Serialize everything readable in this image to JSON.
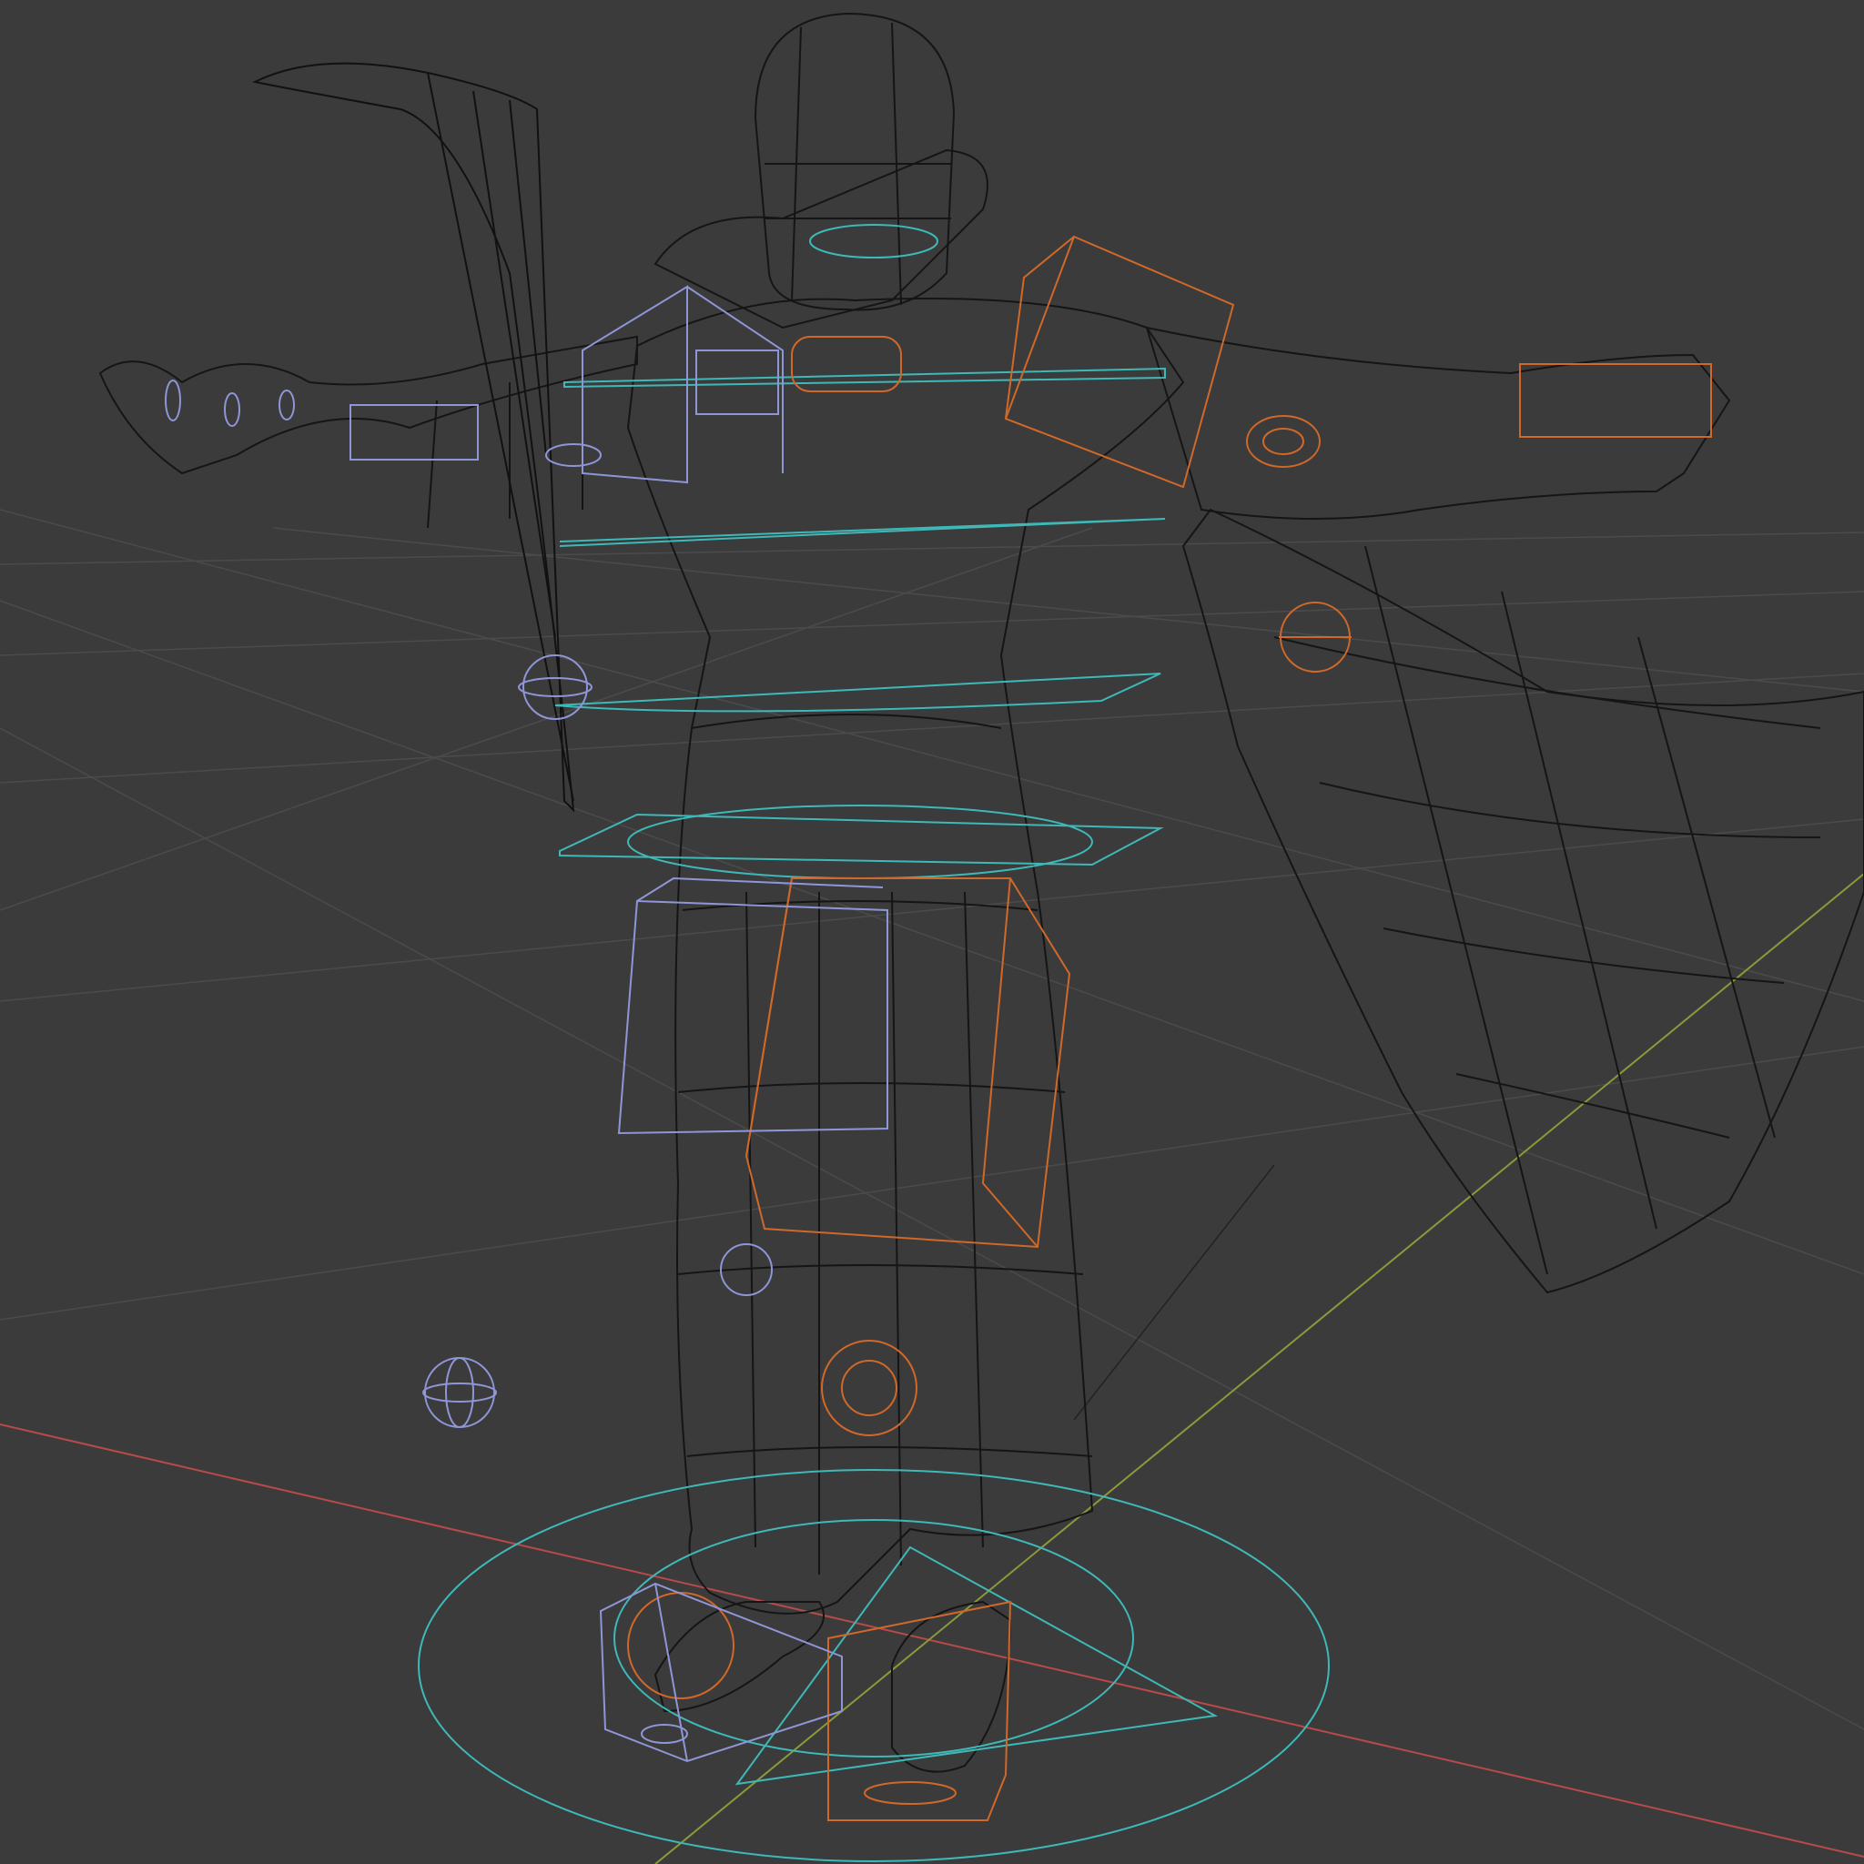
{
  "viewport": {
    "label": "",
    "shading": "wireframe",
    "background": "#3b3b3b",
    "grid_color": "#4a4a4a"
  },
  "colors": {
    "grid_line": "#4b4b4b",
    "axis_x": "#b84a4a",
    "axis_y": "#8a9a3a",
    "mesh_wire": "#111111",
    "control_cyan": "#3fb8b8",
    "control_orange": "#d0682a",
    "control_lavender": "#8f96d8"
  },
  "scene": {
    "objects": [
      {
        "name": "character-mesh",
        "type": "mesh",
        "display": "wireframe"
      },
      {
        "name": "scythe-mesh",
        "type": "mesh",
        "display": "wireframe"
      },
      {
        "name": "armature-controls",
        "type": "rig",
        "display": "bone shapes"
      }
    ]
  },
  "icons": [
    "axis-x-line-icon",
    "axis-y-line-icon",
    "cyan-ring-control-icon",
    "orange-box-control-icon",
    "lavender-sphere-control-icon"
  ]
}
